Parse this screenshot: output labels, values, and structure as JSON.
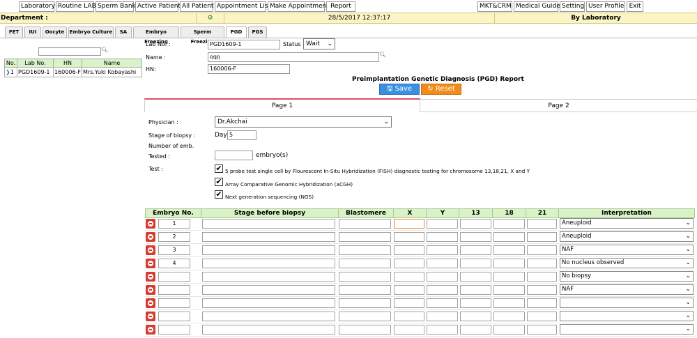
{
  "menu": {
    "items": [
      "Laboratory",
      "Routine LAB",
      "Sperm Bank",
      "Active Patient",
      "All Patient",
      "Appointment List",
      "Make Appointment",
      "Report"
    ],
    "right_items": [
      "MKT&CRM",
      "Medical Guide",
      "Setting",
      "User Profile",
      "Exit"
    ]
  },
  "header": {
    "department_label": "Department :",
    "datetime": "28/5/2017 12:37:17",
    "view_mode": "By Laboratory"
  },
  "tabs": [
    "FET",
    "IUI",
    "Oocyte",
    "Embryo Culture",
    "SA",
    "Embryo Freezing",
    "Sperm Freezing",
    "PGD",
    "PGS"
  ],
  "active_tab": "PGD",
  "patient_list": {
    "search_value": "",
    "columns": [
      "No.",
      "Lab No.",
      "HN",
      "Name"
    ],
    "rows": [
      {
        "no": "1",
        "lab_no": "PGD1609-1",
        "hn": "160006-F",
        "name": "Mrs.Yuki Kobayashi"
      }
    ]
  },
  "form": {
    "lab_no_label": "Lab No. :",
    "lab_no": "PGD1609-1",
    "status_label": "Status :",
    "status": "Wait",
    "name_label": "Name :",
    "name": "ฤqฤ",
    "hn_label": "HN:",
    "hn": "160006-F",
    "report_title": "Preimplantation Genetic Diagnosis (PGD) Report",
    "save_label": "Save",
    "reset_label": "Reset"
  },
  "pages": {
    "page1": "Page 1",
    "page2": "Page 2"
  },
  "page1": {
    "physician_label": "Physician :",
    "physician": "Dr.Akchai",
    "stage_label": "Stage of biopsy :",
    "day_label": "Day",
    "day_value": "5",
    "number_label": "Number of emb.",
    "tested_label": "Tested :",
    "tested_value": "",
    "tested_unit": "embryo(s)",
    "test_label": "Test :",
    "tests": [
      {
        "label": "5 probe test single cell by Flourescent In-Situ Hybridization (FISH) diagnostic testing for chromosome 13,18,21, X and Y",
        "checked": true
      },
      {
        "label": "Array Comparative Genomic Hybridization (aCGH)",
        "checked": true
      },
      {
        "label": "Next generation sequencing (NGS)",
        "checked": true
      }
    ]
  },
  "embryo_table": {
    "columns": [
      "Embryo No.",
      "Stage before biopsy",
      "Blastomere",
      "X",
      "Y",
      "13",
      "18",
      "21",
      "Interpretation"
    ],
    "rows": [
      {
        "embryo_no": "1",
        "interpretation": "Aneuploid"
      },
      {
        "embryo_no": "2",
        "interpretation": "Aneuploid"
      },
      {
        "embryo_no": "3",
        "interpretation": "NAF"
      },
      {
        "embryo_no": "4",
        "interpretation": "No nucleus observed"
      },
      {
        "embryo_no": "",
        "interpretation": "No biopsy"
      },
      {
        "embryo_no": "",
        "interpretation": "NAF"
      },
      {
        "embryo_no": "",
        "interpretation": ""
      },
      {
        "embryo_no": "",
        "interpretation": ""
      },
      {
        "embryo_no": "",
        "interpretation": ""
      }
    ]
  },
  "colors": {
    "save": "#3b8fe0",
    "reset": "#f08c1a",
    "header_bg": "#fbf4c6",
    "grid_header": "#d9f2c6",
    "remove": "#d93b30",
    "active_page_border": "#e0505a"
  }
}
